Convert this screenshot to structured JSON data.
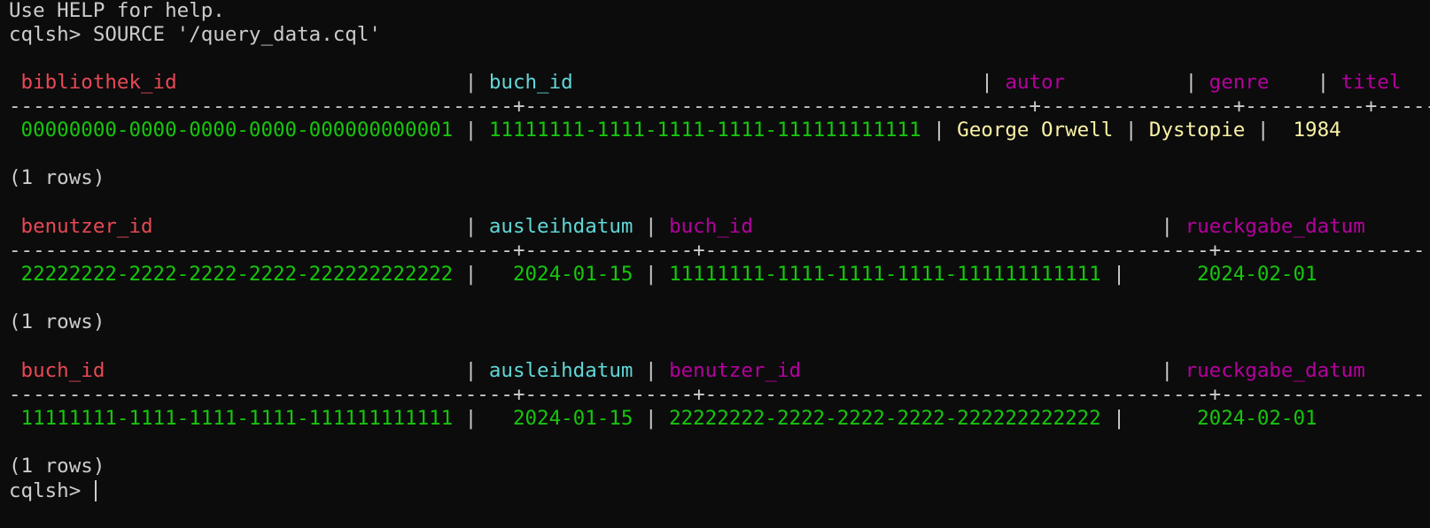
{
  "intro": {
    "help_line": "Use HELP for help.",
    "prompt": "cqlsh>",
    "command": "SOURCE '/query_data.cql'"
  },
  "colors": {
    "partition_key": "#e74856",
    "clustering_key": "#61d6d6",
    "column": "#b4009e",
    "uuid_date_value": "#16c60c",
    "text_value": "#f9f1a5",
    "default_text": "#cccccc",
    "background": "#0c0c0c"
  },
  "tables": [
    {
      "header": [
        "bibliothek_id",
        "buch_id",
        "autor",
        "genre",
        "titel"
      ],
      "separator": "------------------------------------------+------------------------------------------+----------------+----------+-------",
      "row": [
        "00000000-0000-0000-0000-000000000001",
        "11111111-1111-1111-1111-111111111111",
        "George Orwell",
        "Dystopie",
        "1984"
      ],
      "rows_text": "(1 rows)"
    },
    {
      "header": [
        "benutzer_id",
        "ausleihdatum",
        "buch_id",
        "rueckgabe_datum"
      ],
      "separator": "------------------------------------------+--------------+------------------------------------------+-----------------",
      "row": [
        "22222222-2222-2222-2222-222222222222",
        "2024-01-15",
        "11111111-1111-1111-1111-111111111111",
        "2024-02-01"
      ],
      "rows_text": "(1 rows)"
    },
    {
      "header": [
        "buch_id",
        "ausleihdatum",
        "benutzer_id",
        "rueckgabe_datum"
      ],
      "separator": "------------------------------------------+--------------+------------------------------------------+-----------------",
      "row": [
        "11111111-1111-1111-1111-111111111111",
        "2024-01-15",
        "22222222-2222-2222-2222-222222222222",
        "2024-02-01"
      ],
      "rows_text": "(1 rows)"
    }
  ],
  "final_prompt": "cqlsh>"
}
